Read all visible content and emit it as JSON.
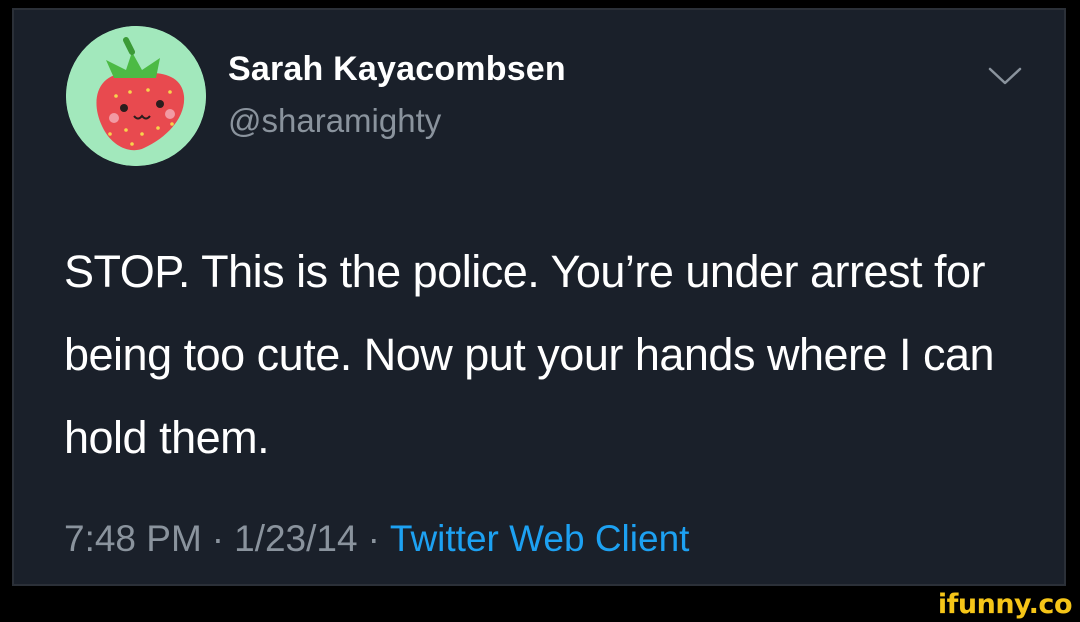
{
  "tweet": {
    "display_name": "Sarah Kayacombsen",
    "handle": "@sharamighty",
    "text": "STOP. This is the police. You’re under arrest for being too cute. Now put your hands where I can hold them.",
    "time": "7:48 PM",
    "date": "1/23/14",
    "separator": "·",
    "client": "Twitter Web Client",
    "avatar_icon": "strawberry-icon",
    "menu_icon": "chevron-down-icon"
  },
  "watermark": {
    "text": "ifunny.co"
  },
  "colors": {
    "card_background": "#1a202a",
    "page_background": "#000000",
    "primary_text": "#ffffff",
    "secondary_text": "#8a939d",
    "link": "#1da1f2",
    "watermark": "#f5c518",
    "avatar_background": "#a2e8bc"
  }
}
